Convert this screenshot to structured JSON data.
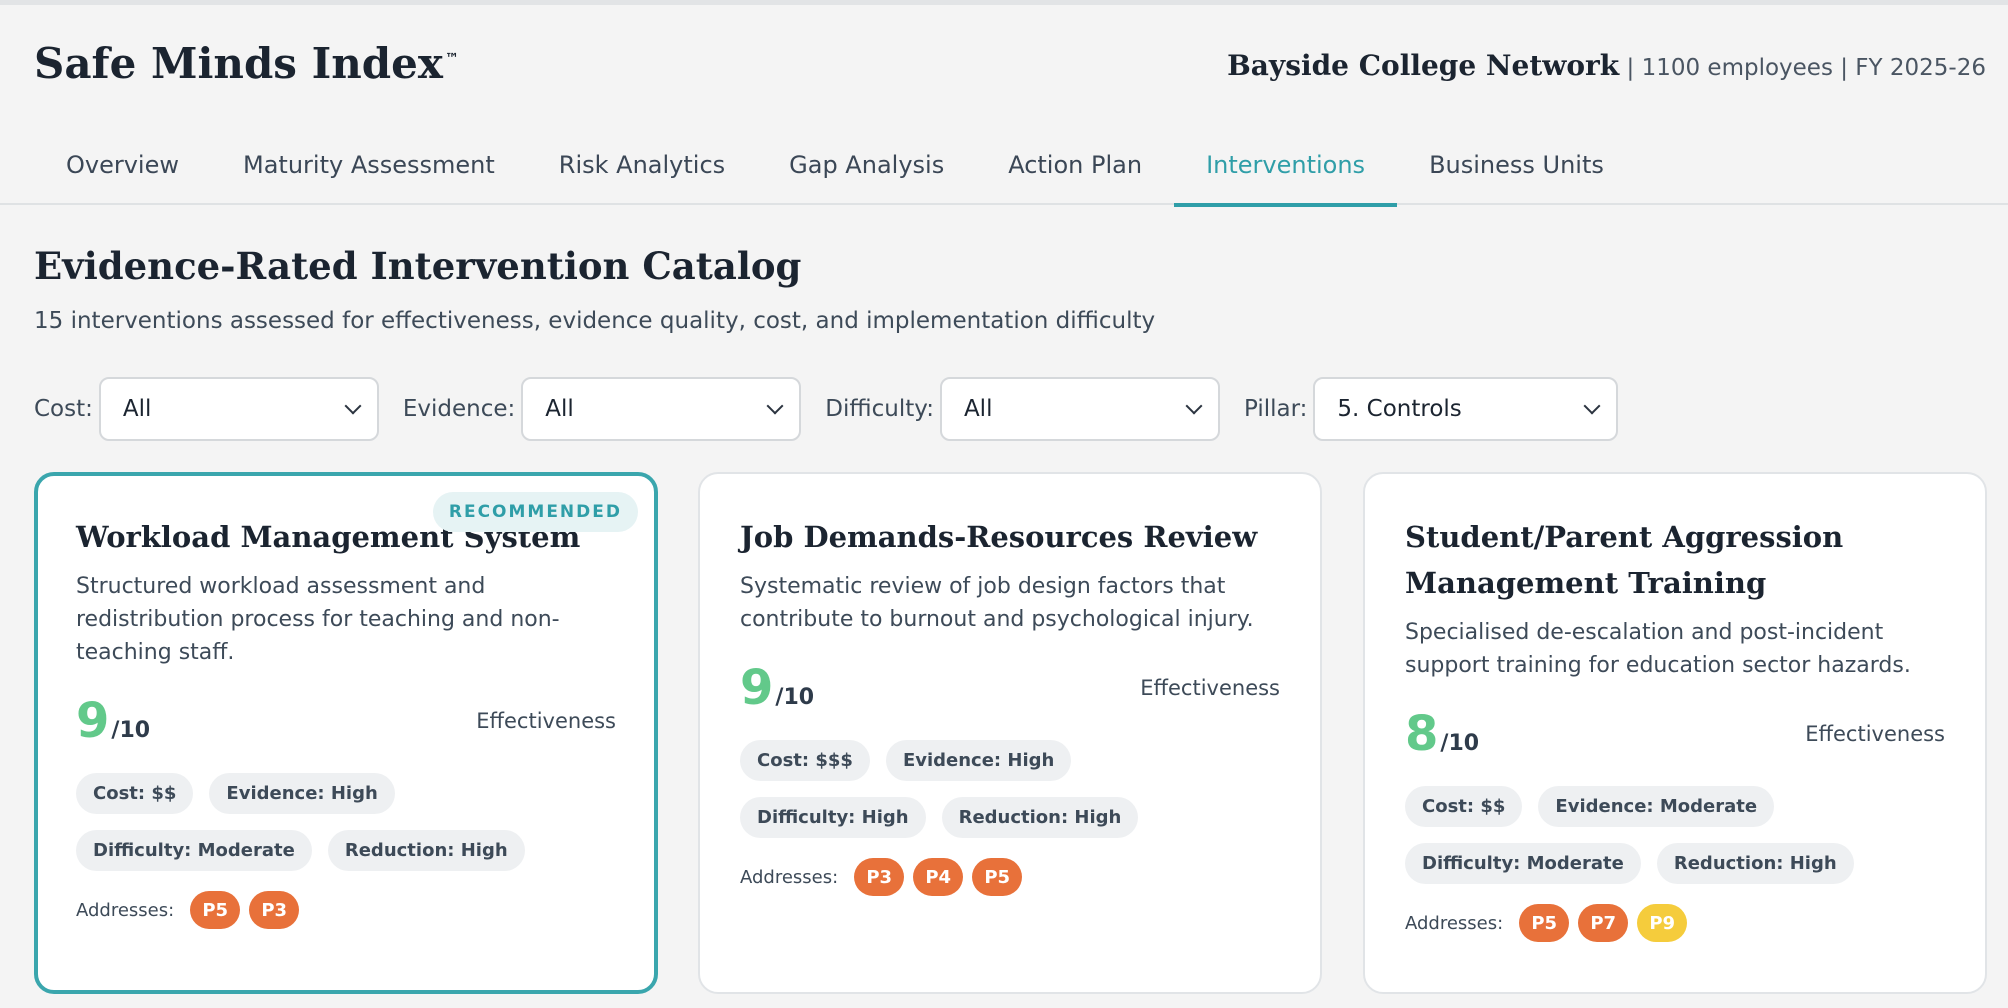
{
  "app": {
    "brand": "Safe Minds Index",
    "trademark": "™",
    "org_name": "Bayside College Network",
    "org_meta": " | 1100 employees | FY 2025-26"
  },
  "tabs": [
    {
      "label": "Overview"
    },
    {
      "label": "Maturity Assessment"
    },
    {
      "label": "Risk Analytics"
    },
    {
      "label": "Gap Analysis"
    },
    {
      "label": "Action Plan"
    },
    {
      "label": "Interventions"
    },
    {
      "label": "Business Units"
    }
  ],
  "active_tab": "Interventions",
  "catalog": {
    "title": "Evidence-Rated Intervention Catalog",
    "subtitle": "15 interventions assessed for effectiveness, evidence quality, cost, and implementation difficulty"
  },
  "filters": [
    {
      "label": "Cost:",
      "value": "All"
    },
    {
      "label": "Evidence:",
      "value": "All"
    },
    {
      "label": "Difficulty:",
      "value": "All"
    },
    {
      "label": "Pillar:",
      "value": "5. Controls"
    }
  ],
  "cards": [
    {
      "badge": "RECOMMENDED",
      "title": "Workload Management System",
      "description": "Structured workload assessment and redistribution process for teaching and non-teaching staff.",
      "score": "9",
      "score_max": "/10",
      "score_label": "Effectiveness",
      "pills": [
        "Cost: $$",
        "Evidence: High",
        "Difficulty: Moderate",
        "Reduction: High"
      ],
      "addresses_label": "Addresses:",
      "addresses": [
        {
          "code": "P5",
          "color": "#e8713a"
        },
        {
          "code": "P3",
          "color": "#e8713a"
        }
      ]
    },
    {
      "title": "Job Demands-Resources Review",
      "description": "Systematic review of job design factors that contribute to burnout and psychological injury.",
      "score": "9",
      "score_max": "/10",
      "score_label": "Effectiveness",
      "pills": [
        "Cost: $$$",
        "Evidence: High",
        "Difficulty: High",
        "Reduction: High"
      ],
      "addresses_label": "Addresses:",
      "addresses": [
        {
          "code": "P3",
          "color": "#e8713a"
        },
        {
          "code": "P4",
          "color": "#e8713a"
        },
        {
          "code": "P5",
          "color": "#e8713a"
        }
      ]
    },
    {
      "title": "Student/Parent Aggression Management Training",
      "description": "Specialised de-escalation and post-incident support training for education sector hazards.",
      "score": "8",
      "score_max": "/10",
      "score_label": "Effectiveness",
      "pills": [
        "Cost: $$",
        "Evidence: Moderate",
        "Difficulty: Moderate",
        "Reduction: High"
      ],
      "addresses_label": "Addresses:",
      "addresses": [
        {
          "code": "P5",
          "color": "#e8713a"
        },
        {
          "code": "P7",
          "color": "#e8713a"
        },
        {
          "code": "P9",
          "color": "#f5cc3c"
        }
      ]
    }
  ],
  "colors": {
    "accent": "#2f9ea8",
    "score_green": "#62c98a",
    "chip_orange": "#e8713a",
    "chip_yellow": "#f5cc3c"
  }
}
